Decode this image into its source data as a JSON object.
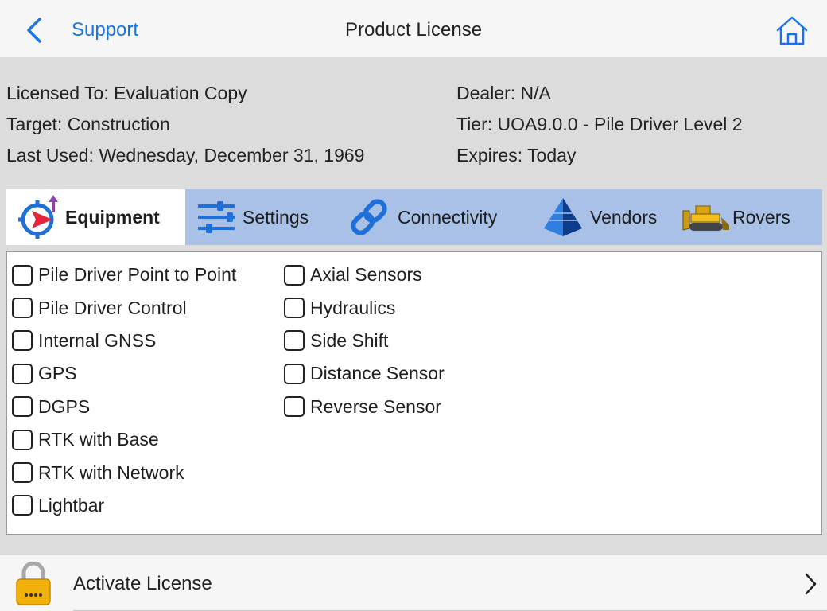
{
  "nav": {
    "back_label": "Support",
    "title": "Product License",
    "home_icon": "home-icon"
  },
  "license": {
    "licensed_to": "Licensed To: Evaluation Copy",
    "target": "Target: Construction",
    "last_used": "Last Used: Wednesday, December 31, 1969",
    "dealer": "Dealer: N/A",
    "tier": "Tier: UOA9.0.0 - Pile Driver Level 2",
    "expires": "Expires: Today"
  },
  "tabs": [
    {
      "label": "Equipment",
      "icon": "equipment-target-icon",
      "active": true
    },
    {
      "label": "Settings",
      "icon": "settings-sliders-icon",
      "active": false
    },
    {
      "label": "Connectivity",
      "icon": "chain-link-icon",
      "active": false
    },
    {
      "label": "Vendors",
      "icon": "pyramid-icon",
      "active": false
    },
    {
      "label": "Rovers",
      "icon": "bulldozer-icon",
      "active": false
    }
  ],
  "equipment": {
    "column1": [
      {
        "label": "Pile Driver Point to Point",
        "checked": false
      },
      {
        "label": "Pile Driver Control",
        "checked": false
      },
      {
        "label": "Internal GNSS",
        "checked": false
      },
      {
        "label": "GPS",
        "checked": false
      },
      {
        "label": "DGPS",
        "checked": false
      },
      {
        "label": "RTK with Base",
        "checked": false
      },
      {
        "label": "RTK with Network",
        "checked": false
      },
      {
        "label": "Lightbar",
        "checked": false
      }
    ],
    "column2": [
      {
        "label": "Axial Sensors",
        "checked": false
      },
      {
        "label": "Hydraulics",
        "checked": false
      },
      {
        "label": "Side Shift",
        "checked": false
      },
      {
        "label": "Distance Sensor",
        "checked": false
      },
      {
        "label": "Reverse Sensor",
        "checked": false
      }
    ]
  },
  "activate": {
    "label": "Activate License",
    "icon": "padlock-icon"
  },
  "colors": {
    "accent": "#1a73e8",
    "tab_bar": "#a9c1e6",
    "background": "#dcdcdc",
    "lock_gold": "#f2b00a"
  }
}
